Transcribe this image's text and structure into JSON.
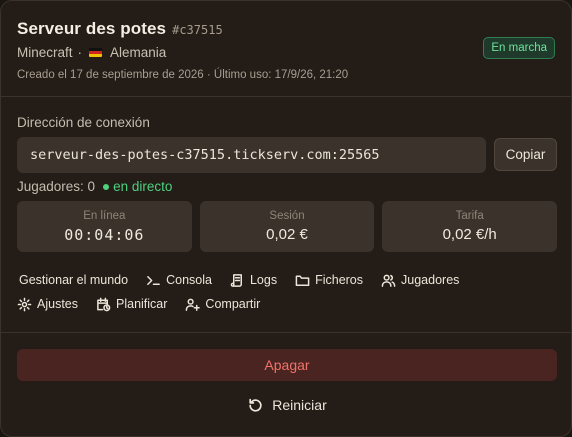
{
  "server": {
    "name": "Serveur des potes",
    "tag": "#c37515",
    "game": "Minecraft",
    "separator": "·",
    "country": "Alemania",
    "meta": "Creado el 17 de septiembre de 2026 · Último uso: 17/9/26, 21:20",
    "status": "En marcha"
  },
  "connection": {
    "label": "Dirección de conexión",
    "address": "serveur-des-potes-c37515.tickserv.com:25565",
    "copy_label": "Copiar"
  },
  "players": {
    "label": "Jugadores: 0",
    "live": "en directo"
  },
  "stats": [
    {
      "label": "En línea",
      "value": "00:04:06"
    },
    {
      "label": "Sesión",
      "value": "0,02 €"
    },
    {
      "label": "Tarifa",
      "value": "0,02 €/h"
    }
  ],
  "actions": {
    "manage_world": "Gestionar el mundo",
    "console": "Consola",
    "logs": "Logs",
    "files": "Ficheros",
    "players": "Jugadores",
    "settings": "Ajustes",
    "schedule": "Planificar",
    "share": "Compartir"
  },
  "buttons": {
    "stop": "Apagar",
    "restart": "Reiniciar"
  },
  "colors": {
    "background": "#231c17",
    "accent_green": "#4ed07f",
    "danger": "#f1726a"
  }
}
